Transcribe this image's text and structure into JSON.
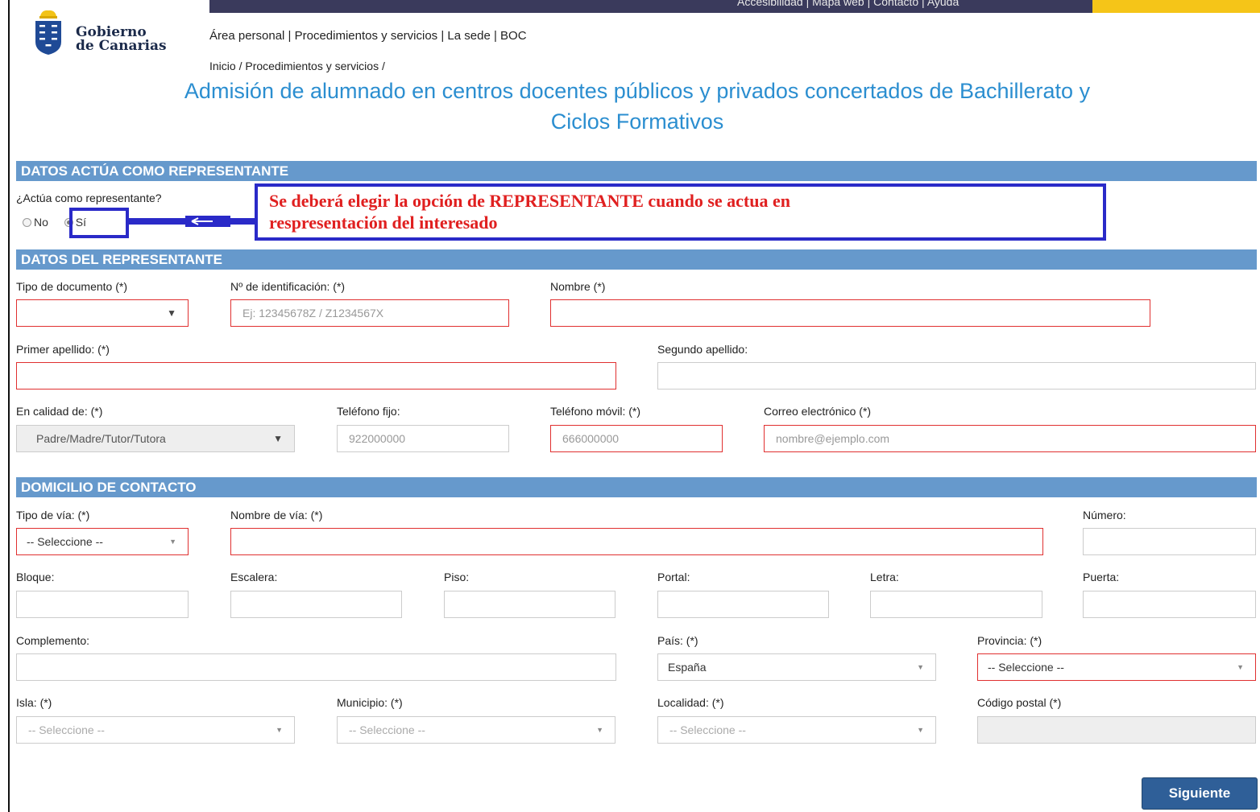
{
  "header": {
    "top_links": "Accesibilidad  |  Mapa web  |  Contacto  |  Ayuda",
    "brand_line1": "Gobierno",
    "brand_line2": "de Canarias",
    "nav": "Área personal | Procedimientos y servicios | La sede | BOC",
    "breadcrumb": "Inicio / Procedimientos y servicios /",
    "colors": {
      "topbar": "#3a3a5c",
      "accent": "#f5c518",
      "title": "#2b8ed0",
      "section": "#6699cc"
    }
  },
  "page_title_line1": "Admisión de alumnado en centros docentes públicos y privados concertados de Bachillerato y",
  "page_title_line2": "Ciclos Formativos",
  "section_representante": {
    "title": "DATOS ACTÚA COMO REPRESENTANTE",
    "question": "¿Actúa como representante?",
    "option_no": "No",
    "option_si": "Sí",
    "selected": "Sí"
  },
  "annotation": {
    "line1": "Se deberá elegir la opción de REPRESENTANTE cuando se actua en",
    "line2": "respresentación del interesado",
    "color": "#e02020",
    "box_color": "#2a2ac8"
  },
  "section_datos": {
    "title": "DATOS DEL REPRESENTANTE",
    "tipo_documento_label": "Tipo de documento (*)",
    "tipo_documento_value": "",
    "num_id_label": "Nº de identificación: (*)",
    "num_id_placeholder": "Ej: 12345678Z / Z1234567X",
    "nombre_label": "Nombre (*)",
    "primer_apellido_label": "Primer apellido: (*)",
    "segundo_apellido_label": "Segundo apellido:",
    "calidad_label": "En calidad de: (*)",
    "calidad_value": "Padre/Madre/Tutor/Tutora",
    "tel_fijo_label": "Teléfono fijo:",
    "tel_fijo_placeholder": "922000000",
    "tel_movil_label": "Teléfono móvil: (*)",
    "tel_movil_placeholder": "666000000",
    "email_label": "Correo electrónico (*)",
    "email_placeholder": "nombre@ejemplo.com"
  },
  "section_domicilio": {
    "title": "DOMICILIO DE CONTACTO",
    "tipo_via_label": "Tipo de vía: (*)",
    "tipo_via_value": "-- Seleccione --",
    "nombre_via_label": "Nombre de vía: (*)",
    "numero_label": "Número:",
    "bloque_label": "Bloque:",
    "escalera_label": "Escalera:",
    "piso_label": "Piso:",
    "portal_label": "Portal:",
    "letra_label": "Letra:",
    "puerta_label": "Puerta:",
    "complemento_label": "Complemento:",
    "pais_label": "País: (*)",
    "pais_value": "España",
    "provincia_label": "Provincia: (*)",
    "provincia_value": "-- Seleccione --",
    "isla_label": "Isla: (*)",
    "isla_value": "-- Seleccione --",
    "municipio_label": "Municipio: (*)",
    "municipio_value": "-- Seleccione --",
    "localidad_label": "Localidad: (*)",
    "localidad_value": "-- Seleccione --",
    "cp_label": "Código postal (*)"
  },
  "actions": {
    "next_label": "Siguiente"
  }
}
